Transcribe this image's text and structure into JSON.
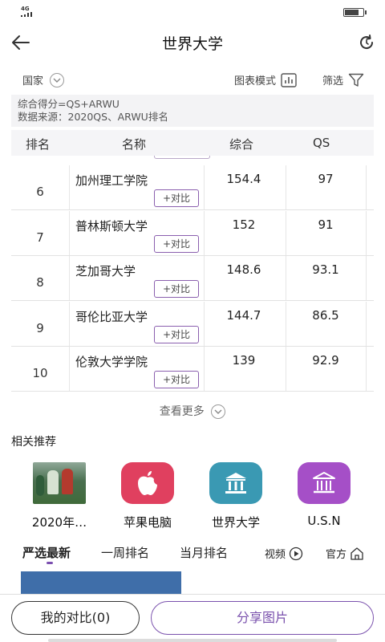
{
  "status": {
    "network": "4G",
    "battery_level": 0.8
  },
  "header": {
    "title": "世界大学",
    "back_icon": "arrow-left-icon",
    "refresh_icon": "refresh-icon"
  },
  "filters": {
    "country_label": "国家",
    "chart_mode_label": "图表模式",
    "filter_label": "筛选"
  },
  "info": {
    "line1": "综合得分=QS+ARWU",
    "line2": "数据来源：2020QS、ARWU排名"
  },
  "table": {
    "columns": [
      "排名",
      "名称",
      "综合",
      "QS"
    ],
    "compare_label": "+对比",
    "rows": [
      {
        "rank": "6",
        "name": "加州理工学院",
        "score": "154.4",
        "qs": "97"
      },
      {
        "rank": "7",
        "name": "普林斯顿大学",
        "score": "152",
        "qs": "91"
      },
      {
        "rank": "8",
        "name": "芝加哥大学",
        "score": "148.6",
        "qs": "93.1"
      },
      {
        "rank": "9",
        "name": "哥伦比亚大学",
        "score": "144.7",
        "qs": "86.5"
      },
      {
        "rank": "10",
        "name": "伦敦大学学院",
        "score": "139",
        "qs": "92.9"
      }
    ]
  },
  "see_more": "查看更多",
  "related": {
    "title": "相关推荐",
    "items": [
      {
        "label": "2020年…",
        "icon": "football-photo"
      },
      {
        "label": "苹果电脑",
        "icon": "apple-icon",
        "color": "#e0405f"
      },
      {
        "label": "世界大学",
        "icon": "building-icon",
        "color": "#3a99b3"
      },
      {
        "label": "U.S.N",
        "icon": "institution-icon",
        "color": "#a54fc7"
      }
    ]
  },
  "tabs": {
    "items": [
      "严选最新",
      "一周排名",
      "当月排名"
    ],
    "video_label": "视频",
    "official_label": "官方"
  },
  "bottom": {
    "my_compare": "我的对比(0)",
    "share": "分享图片"
  },
  "colors": {
    "accent": "#7a51ad",
    "apple_bg": "#e0405f",
    "world_bg": "#3a99b3",
    "usn_bg": "#a54fc7"
  }
}
